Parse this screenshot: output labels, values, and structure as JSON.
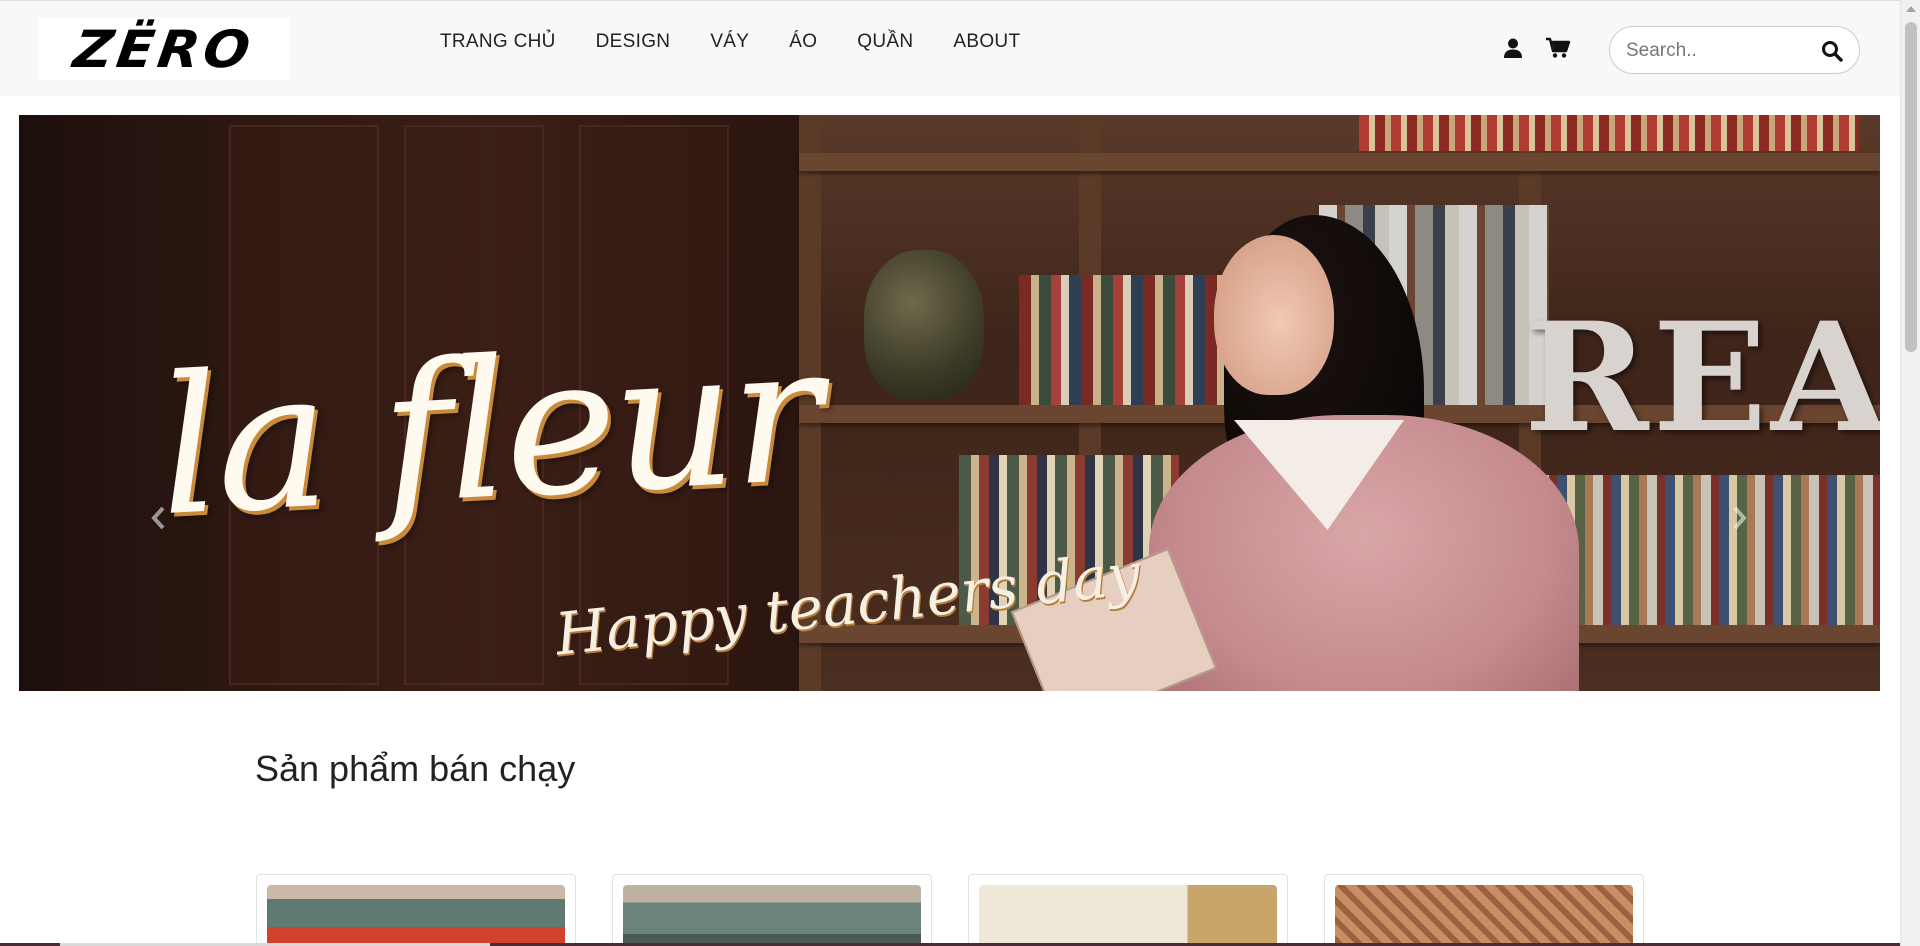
{
  "header": {
    "logo_text": "ZËRO",
    "nav": [
      {
        "label": "TRANG CHỦ"
      },
      {
        "label": "DESIGN"
      },
      {
        "label": "VÁY"
      },
      {
        "label": "ÁO"
      },
      {
        "label": "QUẦN"
      },
      {
        "label": "ABOUT"
      }
    ],
    "icons": {
      "user": "user-icon",
      "cart": "cart-icon",
      "search": "search-icon"
    },
    "search": {
      "placeholder": "Search.."
    }
  },
  "carousel": {
    "script_title": "la fleur",
    "script_subtitle": "Happy teachers day",
    "background_word": "REA",
    "slide_count": 3,
    "active_slide": 3,
    "prev_icon": "chevron-left-icon",
    "next_icon": "chevron-right-icon"
  },
  "best_sellers": {
    "title": "Sản phẩm bán chạy"
  },
  "colors": {
    "header_bg": "#f7f8fa",
    "dress_pink": "#c58b8e",
    "script_gold": "#c98a3a"
  }
}
